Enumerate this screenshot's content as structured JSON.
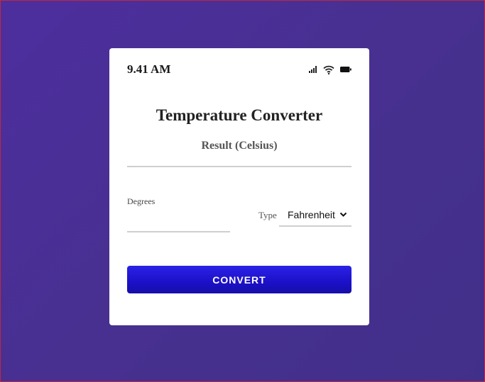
{
  "status_bar": {
    "time": "9.41 AM",
    "icons": [
      "signal-icon",
      "wifi-icon",
      "battery-icon"
    ]
  },
  "converter": {
    "title": "Temperature Converter",
    "result_label": "Result (Celsius)",
    "result_value": "",
    "degrees_label": "Degrees",
    "degrees_value": "",
    "type_label": "Type",
    "type_selected": "Fahrenheit",
    "convert_label": "CONVERT"
  },
  "colors": {
    "background_start": "#4d2e9e",
    "background_end": "#41308a",
    "button": "#1c10c8",
    "card": "#ffffff"
  }
}
